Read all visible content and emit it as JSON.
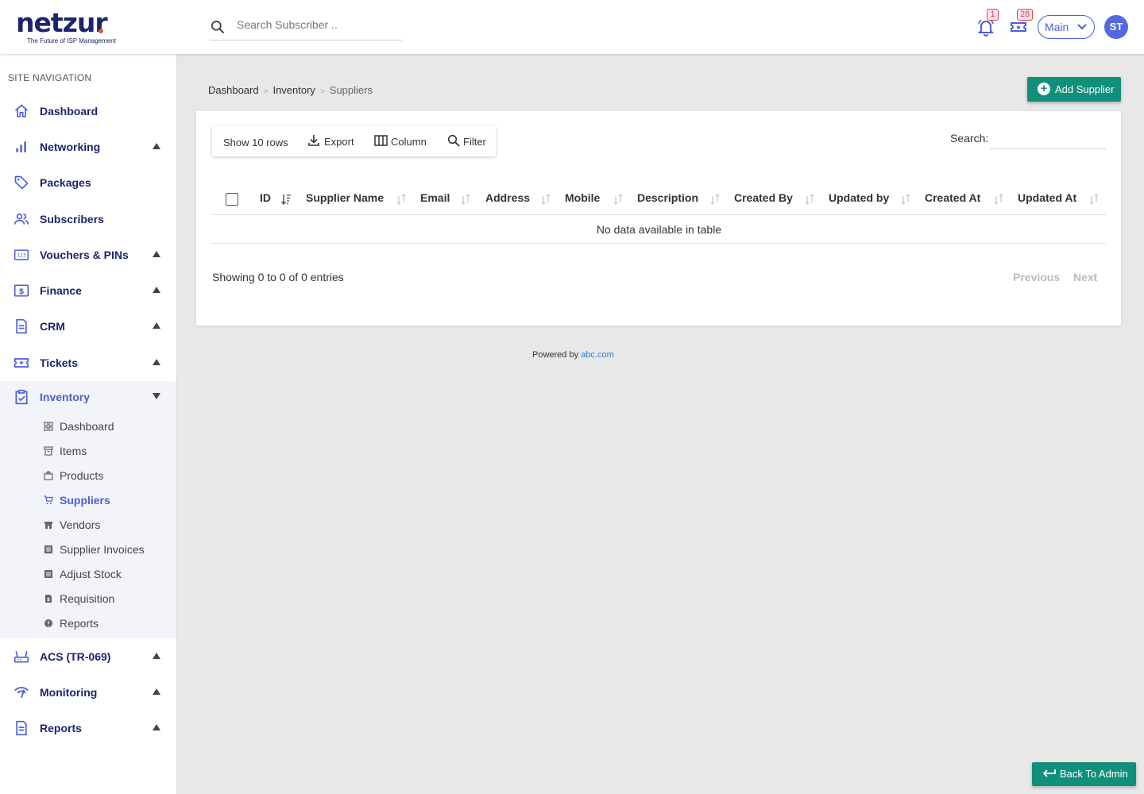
{
  "app": {
    "logo_text": "netzur",
    "logo_tagline": "The Future of ISP Management"
  },
  "header": {
    "search_placeholder": "Search Subscriber ..",
    "notifications_count": "1",
    "tickets_count": "28",
    "workspace_select": "Main",
    "avatar_initials": "ST",
    "icons": [
      "search-icon",
      "bell-icon",
      "ticket-icon",
      "chevron-down-icon"
    ]
  },
  "sidebar": {
    "heading": "SITE NAVIGATION",
    "items": [
      {
        "label": "Dashboard",
        "icon": "home-icon"
      },
      {
        "label": "Networking",
        "icon": "bar-chart-icon"
      },
      {
        "label": "Packages",
        "icon": "tag-icon"
      },
      {
        "label": "Subscribers",
        "icon": "users-icon"
      },
      {
        "label": "Vouchers & PINs",
        "icon": "numbers-icon"
      },
      {
        "label": "Finance",
        "icon": "dollar-icon"
      },
      {
        "label": "CRM",
        "icon": "document-icon"
      },
      {
        "label": "Tickets",
        "icon": "ticket-icon"
      },
      {
        "label": "Inventory",
        "icon": "clipboard-check-icon"
      },
      {
        "label": "ACS (TR-069)",
        "icon": "router-icon"
      },
      {
        "label": "Monitoring",
        "icon": "signal-icon"
      },
      {
        "label": "Reports",
        "icon": "report-icon"
      }
    ],
    "inventory_subitems": [
      {
        "label": "Dashboard",
        "icon": "grid-icon"
      },
      {
        "label": "Items",
        "icon": "archive-icon"
      },
      {
        "label": "Products",
        "icon": "layers-icon"
      },
      {
        "label": "Suppliers",
        "icon": "cart-icon"
      },
      {
        "label": "Vendors",
        "icon": "store-icon"
      },
      {
        "label": "Supplier Invoices",
        "icon": "list-icon"
      },
      {
        "label": "Adjust Stock",
        "icon": "list-icon"
      },
      {
        "label": "Requisition",
        "icon": "file-icon"
      },
      {
        "label": "Reports",
        "icon": "info-icon"
      }
    ],
    "active_subitem": "Suppliers"
  },
  "breadcrumb": [
    "Dashboard",
    "Inventory",
    "Suppliers"
  ],
  "page": {
    "add_button": "Add Supplier",
    "toolbar": {
      "rows": "Show 10 rows",
      "export": "Export",
      "column": "Column",
      "filter": "Filter"
    },
    "search_label": "Search:",
    "columns": [
      "ID",
      "Supplier Name",
      "Email",
      "Address",
      "Mobile",
      "Description",
      "Created By",
      "Updated by",
      "Created At",
      "Updated At"
    ],
    "empty_message": "No data available in table",
    "info": "Showing 0 to 0 of 0 entries",
    "previous": "Previous",
    "next": "Next"
  },
  "footer": {
    "powered_by": "Powered by",
    "powered_link": "abc.com",
    "back_button": "Back To Admin"
  },
  "colors": {
    "brand": "#1c2470",
    "accent": "#4a5fd6",
    "primary_button": "#10907a",
    "badge": "#d9435a"
  }
}
